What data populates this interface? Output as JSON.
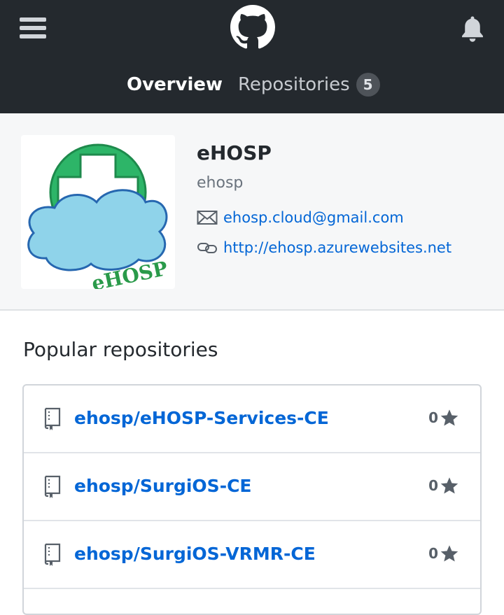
{
  "header": {
    "tabs": [
      {
        "label": "Overview"
      },
      {
        "label": "Repositories",
        "count": "5"
      }
    ]
  },
  "profile": {
    "name": "eHOSP",
    "login": "ehosp",
    "email": "ehosp.cloud@gmail.com",
    "website": "http://ehosp.azurewebsites.net",
    "avatar_text": "eHOSP"
  },
  "popular": {
    "title": "Popular repositories",
    "repos": [
      {
        "name": "ehosp/eHOSP-Services-CE",
        "stars": "0"
      },
      {
        "name": "ehosp/SurgiOS-CE",
        "stars": "0"
      },
      {
        "name": "ehosp/SurgiOS-VRMR-CE",
        "stars": "0"
      }
    ]
  },
  "colors": {
    "header_bg": "#24292e",
    "link": "#0366d6",
    "logo_green": "#2db568",
    "cloud_blue": "#8fd3ea"
  },
  "icons": [
    "menu-icon",
    "github-logo-icon",
    "bell-icon",
    "mail-icon",
    "link-icon",
    "repo-icon",
    "star-icon"
  ]
}
